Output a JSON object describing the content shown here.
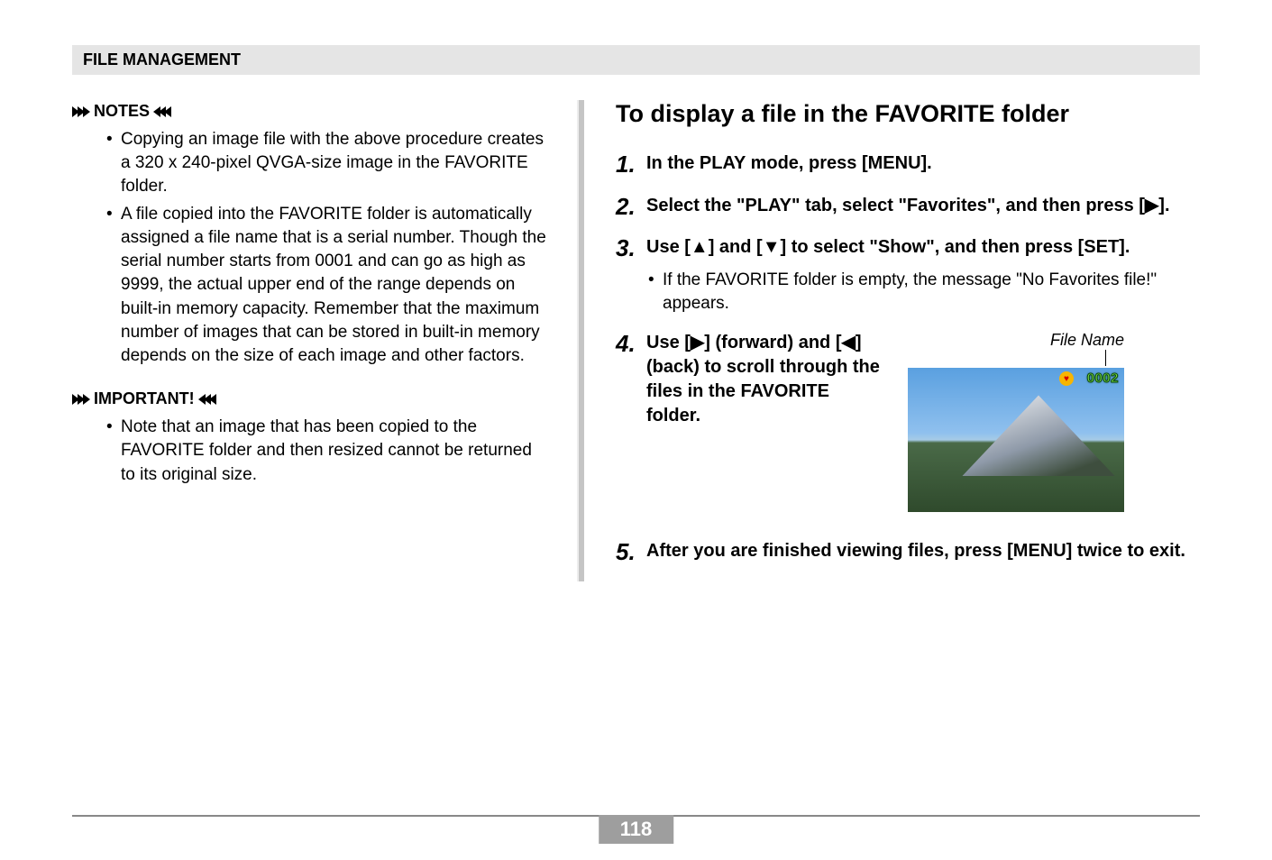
{
  "header": {
    "title": "FILE MANAGEMENT"
  },
  "left": {
    "notes_label": "NOTES",
    "notes": [
      "Copying an image file with the above procedure creates a 320 x 240-pixel QVGA-size image in the FAVORITE folder.",
      "A file copied into the FAVORITE folder is automatically assigned a file name that is a serial number. Though the serial number starts from 0001 and can go as high as 9999, the actual upper end of the range depends on built-in memory capacity. Remember that the maximum number of images that can be stored in built-in memory depends on the size of each image and other factors."
    ],
    "important_label": "IMPORTANT!",
    "important": [
      "Note that an image that has been copied to the FAVORITE folder and then resized cannot be returned to its original size."
    ]
  },
  "right": {
    "heading": "To display a file in the FAVORITE folder",
    "steps": [
      {
        "num": "1.",
        "text": "In the PLAY mode, press [MENU]."
      },
      {
        "num": "2.",
        "text": "Select the \"PLAY\" tab, select \"Favorites\", and then press [▶]."
      },
      {
        "num": "3.",
        "text": "Use [▲] and [▼] to select \"Show\", and then press [SET].",
        "sub": "If the FAVORITE folder is empty, the message \"No Favorites file!\" appears."
      },
      {
        "num": "4.",
        "text": "Use [▶] (forward) and [◀] (back) to scroll through the files in the FAVORITE folder."
      },
      {
        "num": "5.",
        "text": "After you are finished viewing files, press [MENU] twice to exit."
      }
    ],
    "figure": {
      "caption": "File Name",
      "file_number": "0002"
    }
  },
  "page_number": "118"
}
